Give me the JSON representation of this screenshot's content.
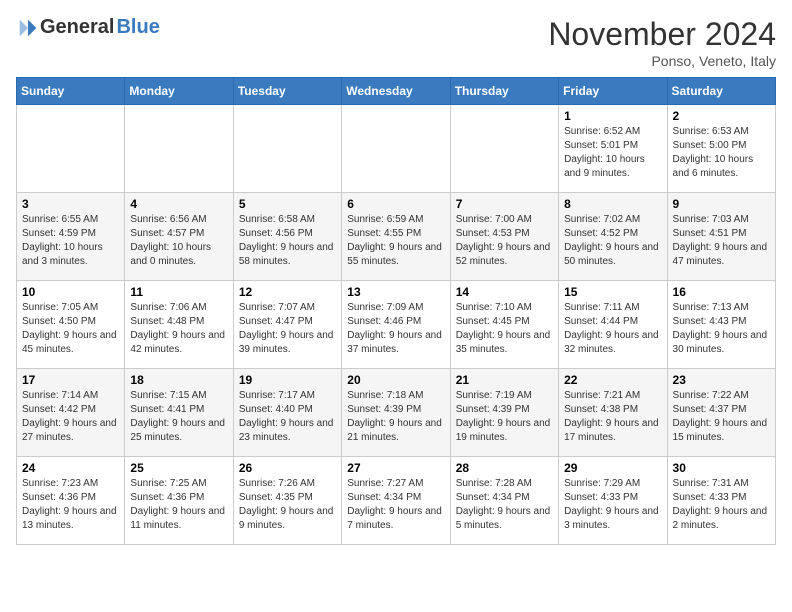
{
  "logo": {
    "general": "General",
    "blue": "Blue"
  },
  "title": "November 2024",
  "location": "Ponso, Veneto, Italy",
  "days_of_week": [
    "Sunday",
    "Monday",
    "Tuesday",
    "Wednesday",
    "Thursday",
    "Friday",
    "Saturday"
  ],
  "weeks": [
    [
      {
        "day": "",
        "info": ""
      },
      {
        "day": "",
        "info": ""
      },
      {
        "day": "",
        "info": ""
      },
      {
        "day": "",
        "info": ""
      },
      {
        "day": "",
        "info": ""
      },
      {
        "day": "1",
        "info": "Sunrise: 6:52 AM\nSunset: 5:01 PM\nDaylight: 10 hours and 9 minutes."
      },
      {
        "day": "2",
        "info": "Sunrise: 6:53 AM\nSunset: 5:00 PM\nDaylight: 10 hours and 6 minutes."
      }
    ],
    [
      {
        "day": "3",
        "info": "Sunrise: 6:55 AM\nSunset: 4:59 PM\nDaylight: 10 hours and 3 minutes."
      },
      {
        "day": "4",
        "info": "Sunrise: 6:56 AM\nSunset: 4:57 PM\nDaylight: 10 hours and 0 minutes."
      },
      {
        "day": "5",
        "info": "Sunrise: 6:58 AM\nSunset: 4:56 PM\nDaylight: 9 hours and 58 minutes."
      },
      {
        "day": "6",
        "info": "Sunrise: 6:59 AM\nSunset: 4:55 PM\nDaylight: 9 hours and 55 minutes."
      },
      {
        "day": "7",
        "info": "Sunrise: 7:00 AM\nSunset: 4:53 PM\nDaylight: 9 hours and 52 minutes."
      },
      {
        "day": "8",
        "info": "Sunrise: 7:02 AM\nSunset: 4:52 PM\nDaylight: 9 hours and 50 minutes."
      },
      {
        "day": "9",
        "info": "Sunrise: 7:03 AM\nSunset: 4:51 PM\nDaylight: 9 hours and 47 minutes."
      }
    ],
    [
      {
        "day": "10",
        "info": "Sunrise: 7:05 AM\nSunset: 4:50 PM\nDaylight: 9 hours and 45 minutes."
      },
      {
        "day": "11",
        "info": "Sunrise: 7:06 AM\nSunset: 4:48 PM\nDaylight: 9 hours and 42 minutes."
      },
      {
        "day": "12",
        "info": "Sunrise: 7:07 AM\nSunset: 4:47 PM\nDaylight: 9 hours and 39 minutes."
      },
      {
        "day": "13",
        "info": "Sunrise: 7:09 AM\nSunset: 4:46 PM\nDaylight: 9 hours and 37 minutes."
      },
      {
        "day": "14",
        "info": "Sunrise: 7:10 AM\nSunset: 4:45 PM\nDaylight: 9 hours and 35 minutes."
      },
      {
        "day": "15",
        "info": "Sunrise: 7:11 AM\nSunset: 4:44 PM\nDaylight: 9 hours and 32 minutes."
      },
      {
        "day": "16",
        "info": "Sunrise: 7:13 AM\nSunset: 4:43 PM\nDaylight: 9 hours and 30 minutes."
      }
    ],
    [
      {
        "day": "17",
        "info": "Sunrise: 7:14 AM\nSunset: 4:42 PM\nDaylight: 9 hours and 27 minutes."
      },
      {
        "day": "18",
        "info": "Sunrise: 7:15 AM\nSunset: 4:41 PM\nDaylight: 9 hours and 25 minutes."
      },
      {
        "day": "19",
        "info": "Sunrise: 7:17 AM\nSunset: 4:40 PM\nDaylight: 9 hours and 23 minutes."
      },
      {
        "day": "20",
        "info": "Sunrise: 7:18 AM\nSunset: 4:39 PM\nDaylight: 9 hours and 21 minutes."
      },
      {
        "day": "21",
        "info": "Sunrise: 7:19 AM\nSunset: 4:39 PM\nDaylight: 9 hours and 19 minutes."
      },
      {
        "day": "22",
        "info": "Sunrise: 7:21 AM\nSunset: 4:38 PM\nDaylight: 9 hours and 17 minutes."
      },
      {
        "day": "23",
        "info": "Sunrise: 7:22 AM\nSunset: 4:37 PM\nDaylight: 9 hours and 15 minutes."
      }
    ],
    [
      {
        "day": "24",
        "info": "Sunrise: 7:23 AM\nSunset: 4:36 PM\nDaylight: 9 hours and 13 minutes."
      },
      {
        "day": "25",
        "info": "Sunrise: 7:25 AM\nSunset: 4:36 PM\nDaylight: 9 hours and 11 minutes."
      },
      {
        "day": "26",
        "info": "Sunrise: 7:26 AM\nSunset: 4:35 PM\nDaylight: 9 hours and 9 minutes."
      },
      {
        "day": "27",
        "info": "Sunrise: 7:27 AM\nSunset: 4:34 PM\nDaylight: 9 hours and 7 minutes."
      },
      {
        "day": "28",
        "info": "Sunrise: 7:28 AM\nSunset: 4:34 PM\nDaylight: 9 hours and 5 minutes."
      },
      {
        "day": "29",
        "info": "Sunrise: 7:29 AM\nSunset: 4:33 PM\nDaylight: 9 hours and 3 minutes."
      },
      {
        "day": "30",
        "info": "Sunrise: 7:31 AM\nSunset: 4:33 PM\nDaylight: 9 hours and 2 minutes."
      }
    ]
  ]
}
